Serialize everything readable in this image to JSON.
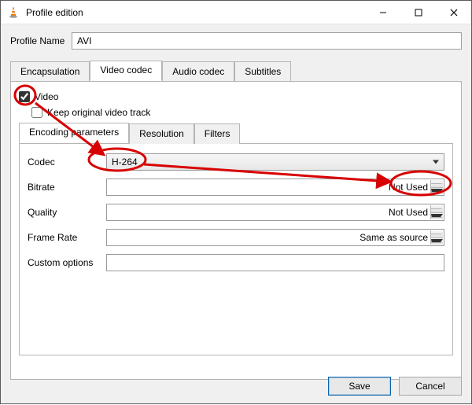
{
  "window": {
    "title": "Profile edition"
  },
  "profile": {
    "label": "Profile Name",
    "value": "AVI"
  },
  "outerTabs": {
    "items": [
      "Encapsulation",
      "Video codec",
      "Audio codec",
      "Subtitles"
    ],
    "activeIndex": 1
  },
  "videoPage": {
    "videoCheckbox": {
      "label": "Video",
      "checked": true
    },
    "keepOriginal": {
      "label": "Keep original video track",
      "checked": false
    }
  },
  "innerTabs": {
    "items": [
      "Encoding parameters",
      "Resolution",
      "Filters"
    ],
    "activeIndex": 0
  },
  "encoding": {
    "codec": {
      "label": "Codec",
      "value": "H-264"
    },
    "bitrate": {
      "label": "Bitrate",
      "value": "Not Used"
    },
    "quality": {
      "label": "Quality",
      "value": "Not Used"
    },
    "frameRate": {
      "label": "Frame Rate",
      "value": "Same as source"
    },
    "customOptions": {
      "label": "Custom options",
      "value": ""
    }
  },
  "footer": {
    "save": "Save",
    "cancel": "Cancel"
  }
}
